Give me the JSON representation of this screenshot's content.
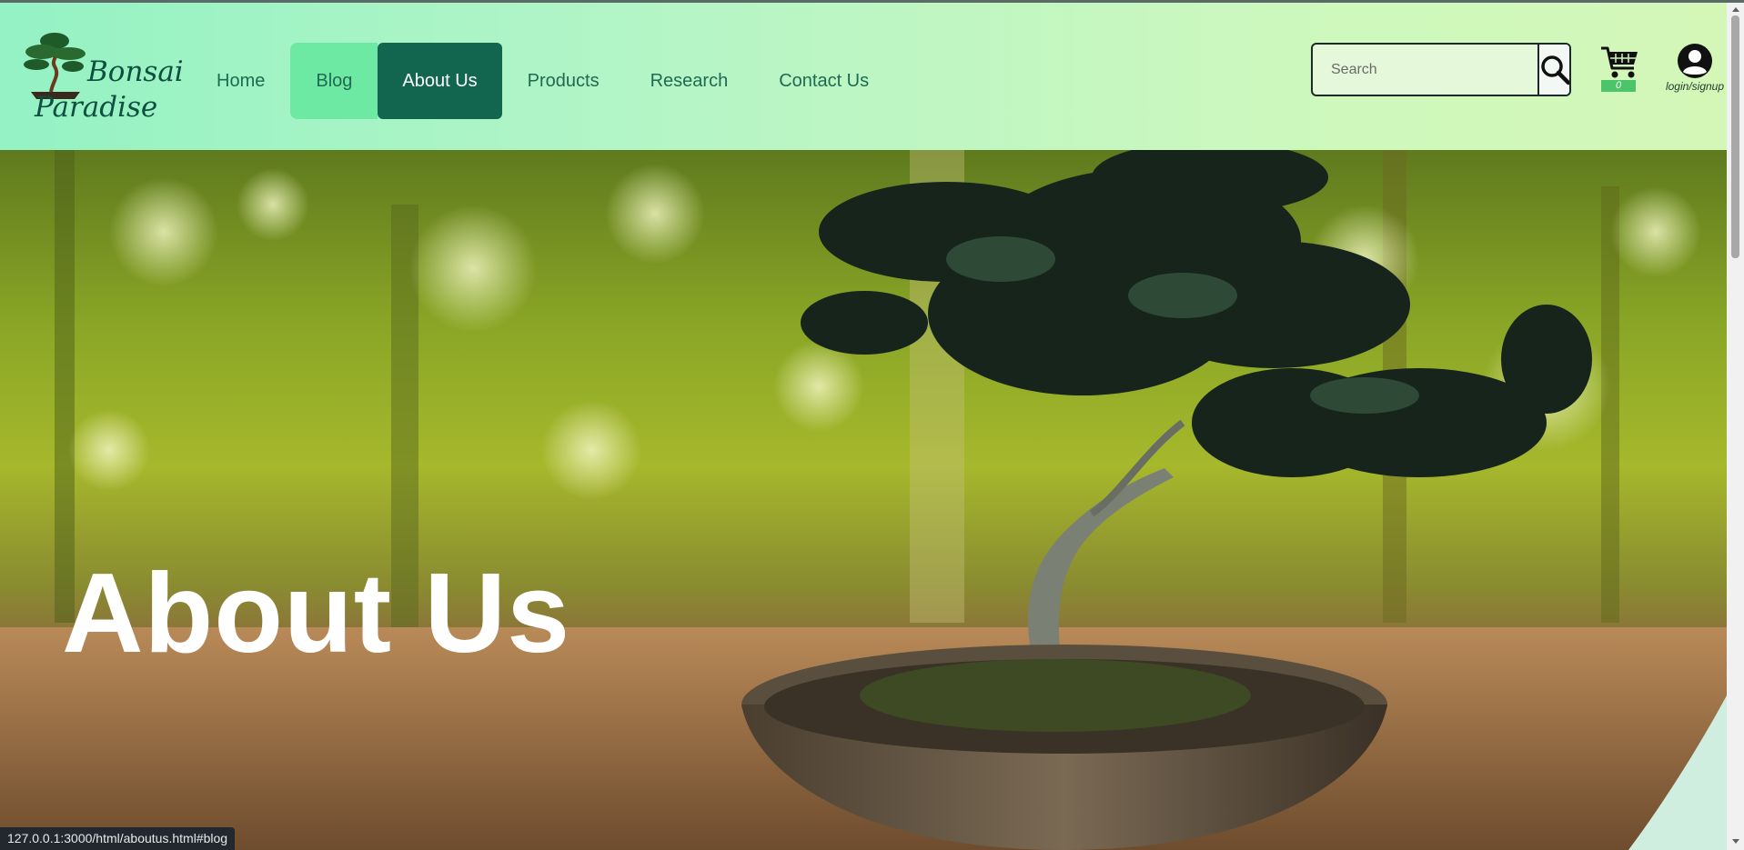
{
  "header": {
    "logo": {
      "line1": "Bonsai",
      "line2": "Paradise"
    },
    "nav": [
      {
        "label": "Home",
        "state": "normal"
      },
      {
        "label": "Blog",
        "state": "hover"
      },
      {
        "label": "About Us",
        "state": "active"
      },
      {
        "label": "Products",
        "state": "normal"
      },
      {
        "label": "Research",
        "state": "normal"
      },
      {
        "label": "Contact Us",
        "state": "normal"
      }
    ],
    "search": {
      "placeholder": "Search",
      "icon": "search-icon"
    },
    "cart": {
      "icon": "cart-icon",
      "count": "0"
    },
    "account": {
      "icon": "user-icon",
      "label": "login/signup"
    }
  },
  "hero": {
    "title": "About Us"
  },
  "status_bar": {
    "url": "127.0.0.1:3000/html/aboutus.html#blog"
  },
  "colors": {
    "active_nav": "#126650",
    "hover_nav": "#6ee9a3",
    "nav_text": "#1f6a50",
    "cart_badge": "#4bc46a"
  }
}
